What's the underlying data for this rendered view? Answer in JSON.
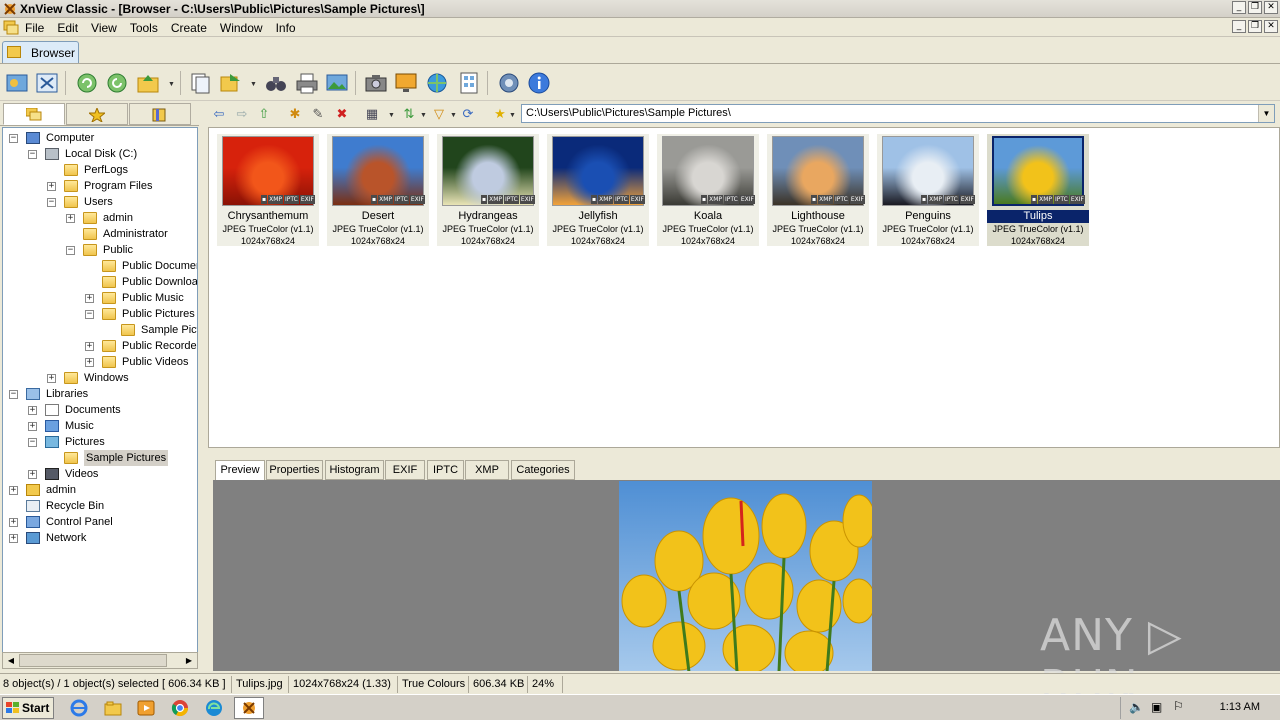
{
  "window": {
    "title": "XnView Classic - [Browser - C:\\Users\\Public\\Pictures\\Sample Pictures\\]",
    "controls": [
      "_",
      "❐",
      "✕"
    ]
  },
  "menu": [
    "File",
    "Edit",
    "View",
    "Tools",
    "Create",
    "Window",
    "Info"
  ],
  "tabs": {
    "browser": "Browser"
  },
  "tree": {
    "items": [
      {
        "label": "Computer",
        "depth": 0,
        "expander": "-",
        "icon": "computer"
      },
      {
        "label": "Local Disk (C:)",
        "depth": 1,
        "expander": "-",
        "icon": "drive"
      },
      {
        "label": "PerfLogs",
        "depth": 2,
        "expander": "",
        "icon": "folder"
      },
      {
        "label": "Program Files",
        "depth": 2,
        "expander": "+",
        "icon": "folder"
      },
      {
        "label": "Users",
        "depth": 2,
        "expander": "-",
        "icon": "folder"
      },
      {
        "label": "admin",
        "depth": 3,
        "expander": "+",
        "icon": "folder"
      },
      {
        "label": "Administrator",
        "depth": 3,
        "expander": "",
        "icon": "folder"
      },
      {
        "label": "Public",
        "depth": 3,
        "expander": "-",
        "icon": "folder"
      },
      {
        "label": "Public Documents",
        "depth": 4,
        "expander": "",
        "icon": "folder"
      },
      {
        "label": "Public Downloads",
        "depth": 4,
        "expander": "",
        "icon": "folder"
      },
      {
        "label": "Public Music",
        "depth": 4,
        "expander": "+",
        "icon": "folder"
      },
      {
        "label": "Public Pictures",
        "depth": 4,
        "expander": "-",
        "icon": "folder"
      },
      {
        "label": "Sample Pictures",
        "depth": 5,
        "expander": "",
        "icon": "folder"
      },
      {
        "label": "Public Recorded TV",
        "depth": 4,
        "expander": "+",
        "icon": "folder"
      },
      {
        "label": "Public Videos",
        "depth": 4,
        "expander": "+",
        "icon": "folder"
      },
      {
        "label": "Windows",
        "depth": 2,
        "expander": "+",
        "icon": "folder"
      },
      {
        "label": "Libraries",
        "depth": 0,
        "expander": "-",
        "icon": "libraries"
      },
      {
        "label": "Documents",
        "depth": 1,
        "expander": "+",
        "icon": "documents"
      },
      {
        "label": "Music",
        "depth": 1,
        "expander": "+",
        "icon": "music"
      },
      {
        "label": "Pictures",
        "depth": 1,
        "expander": "-",
        "icon": "pictures"
      },
      {
        "label": "Sample Pictures",
        "depth": 2,
        "expander": "",
        "icon": "folder",
        "selected": true
      },
      {
        "label": "Videos",
        "depth": 1,
        "expander": "+",
        "icon": "videos"
      },
      {
        "label": "admin",
        "depth": 0,
        "expander": "+",
        "icon": "user"
      },
      {
        "label": "Recycle Bin",
        "depth": 0,
        "expander": "",
        "icon": "recycle"
      },
      {
        "label": "Control Panel",
        "depth": 0,
        "expander": "+",
        "icon": "control"
      },
      {
        "label": "Network",
        "depth": 0,
        "expander": "+",
        "icon": "network"
      }
    ]
  },
  "address": {
    "path": "C:\\Users\\Public\\Pictures\\Sample Pictures\\"
  },
  "thumbnails": [
    {
      "name": "Chrysanthemum",
      "format": "JPEG TrueColor (v1.1)",
      "dims": "1024x768x24",
      "colors": [
        "#d7220c",
        "#f2561a",
        "#8a1205"
      ]
    },
    {
      "name": "Desert",
      "format": "JPEG TrueColor (v1.1)",
      "dims": "1024x768x24",
      "colors": [
        "#3f7ccf",
        "#b9542a",
        "#7a2e12"
      ]
    },
    {
      "name": "Hydrangeas",
      "format": "JPEG TrueColor (v1.1)",
      "dims": "1024x768x24",
      "colors": [
        "#21451c",
        "#bfcbe0",
        "#e9e4b6"
      ]
    },
    {
      "name": "Jellyfish",
      "format": "JPEG TrueColor (v1.1)",
      "dims": "1024x768x24",
      "colors": [
        "#0a2a7a",
        "#1a4fb3",
        "#f1a23a"
      ]
    },
    {
      "name": "Koala",
      "format": "JPEG TrueColor (v1.1)",
      "dims": "1024x768x24",
      "colors": [
        "#9a9a96",
        "#d8d6d2",
        "#3a3a34"
      ]
    },
    {
      "name": "Lighthouse",
      "format": "JPEG TrueColor (v1.1)",
      "dims": "1024x768x24",
      "colors": [
        "#6f8fb8",
        "#e9a760",
        "#3b3226"
      ]
    },
    {
      "name": "Penguins",
      "format": "JPEG TrueColor (v1.1)",
      "dims": "1024x768x24",
      "colors": [
        "#9fc1e6",
        "#e8eef4",
        "#1a1a22"
      ]
    },
    {
      "name": "Tulips",
      "format": "JPEG TrueColor (v1.1)",
      "dims": "1024x768x24",
      "colors": [
        "#5d9ad8",
        "#f2c21a",
        "#4a7a20"
      ],
      "selected": true
    }
  ],
  "badges": [
    "▪",
    "XMP",
    "IPTC",
    "EXIF"
  ],
  "preview_tabs": [
    "Preview",
    "Properties",
    "Histogram",
    "EXIF",
    "IPTC",
    "XMP",
    "Categories"
  ],
  "watermark": "ANY ▷ RUN",
  "status": {
    "selection": "8 object(s) / 1 object(s) selected  [ 606.34 KB ]",
    "filename": "Tulips.jpg",
    "dims": "1024x768x24 (1.33)",
    "colors": "True Colours",
    "size": "606.34 KB",
    "zoom": "24%"
  },
  "taskbar": {
    "start": "Start",
    "clock": "1:13 AM"
  }
}
